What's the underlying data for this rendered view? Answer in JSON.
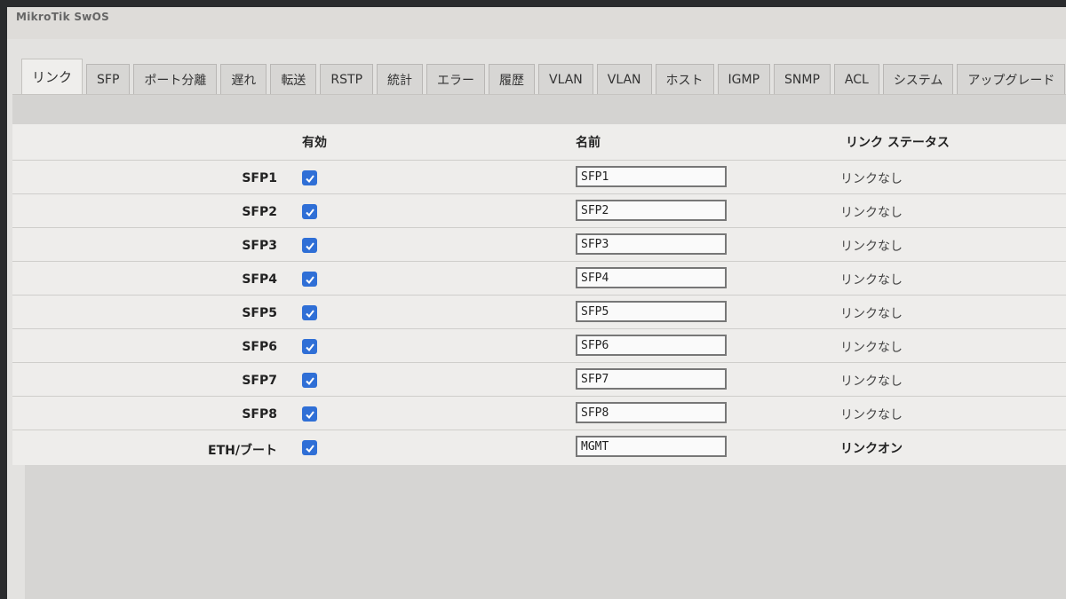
{
  "app": {
    "title": "MikroTik SwOS"
  },
  "tabs": [
    {
      "label": "リンク",
      "active": true
    },
    {
      "label": "SFP"
    },
    {
      "label": "ポート分離"
    },
    {
      "label": "遅れ"
    },
    {
      "label": "転送"
    },
    {
      "label": "RSTP"
    },
    {
      "label": "統計"
    },
    {
      "label": "エラー"
    },
    {
      "label": "履歴"
    },
    {
      "label": "VLAN"
    },
    {
      "label": "VLAN"
    },
    {
      "label": "ホスト"
    },
    {
      "label": "IGMP"
    },
    {
      "label": "SNMP"
    },
    {
      "label": "ACL"
    },
    {
      "label": "システム"
    },
    {
      "label": "アップグレード"
    }
  ],
  "table": {
    "headers": {
      "enabled": "有効",
      "name": "名前",
      "link_status": "リンク ステータス"
    },
    "rows": [
      {
        "port": "SFP1",
        "enabled": true,
        "name": "SFP1",
        "status": "リンクなし"
      },
      {
        "port": "SFP2",
        "enabled": true,
        "name": "SFP2",
        "status": "リンクなし"
      },
      {
        "port": "SFP3",
        "enabled": true,
        "name": "SFP3",
        "status": "リンクなし"
      },
      {
        "port": "SFP4",
        "enabled": true,
        "name": "SFP4",
        "status": "リンクなし"
      },
      {
        "port": "SFP5",
        "enabled": true,
        "name": "SFP5",
        "status": "リンクなし"
      },
      {
        "port": "SFP6",
        "enabled": true,
        "name": "SFP6",
        "status": "リンクなし"
      },
      {
        "port": "SFP7",
        "enabled": true,
        "name": "SFP7",
        "status": "リンクなし"
      },
      {
        "port": "SFP8",
        "enabled": true,
        "name": "SFP8",
        "status": "リンクなし"
      },
      {
        "port": "ETH/ブート",
        "enabled": true,
        "name": "MGMT",
        "status": "リンクオン"
      }
    ]
  },
  "colors": {
    "checkbox": "#2f6fd6",
    "background": "#e3e2e0"
  }
}
